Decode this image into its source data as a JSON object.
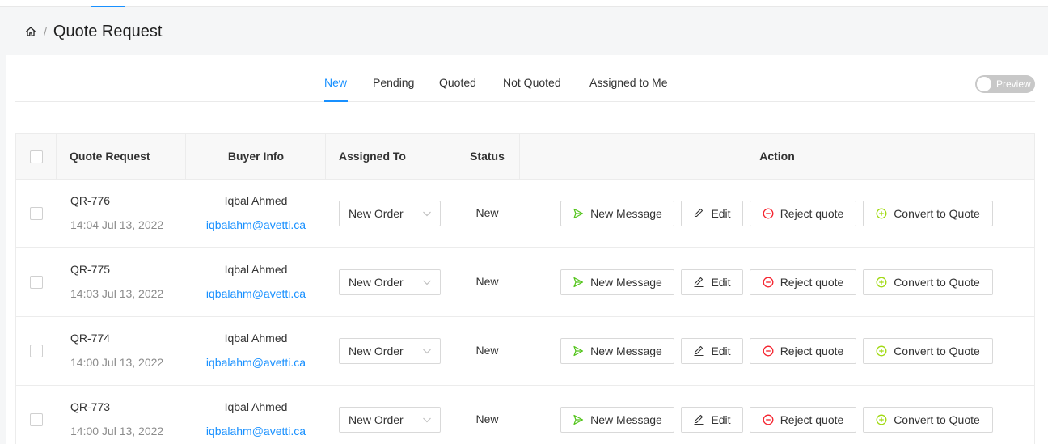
{
  "header": {
    "title": "Quote Request",
    "home_icon": "home-icon"
  },
  "tabs": [
    {
      "label": "New",
      "active": true
    },
    {
      "label": "Pending",
      "active": false
    },
    {
      "label": "Quoted",
      "active": false
    },
    {
      "label": "Not Quoted",
      "active": false
    },
    {
      "label": "Assigned to Me",
      "active": false
    }
  ],
  "preview_toggle": {
    "label": "Preview",
    "on": false
  },
  "table": {
    "columns": [
      "Quote Request",
      "Buyer Info",
      "Assigned To",
      "Status",
      "Action"
    ],
    "actions": {
      "new_message": "New Message",
      "edit": "Edit",
      "reject": "Reject quote",
      "convert": "Convert to Quote"
    },
    "rows": [
      {
        "id": "QR-776",
        "date": "14:04 Jul 13, 2022",
        "buyer_name": "Iqbal Ahmed",
        "buyer_email": "iqbalahm@avetti.ca",
        "assigned_to": "New Order",
        "status": "New"
      },
      {
        "id": "QR-775",
        "date": "14:03 Jul 13, 2022",
        "buyer_name": "Iqbal Ahmed",
        "buyer_email": "iqbalahm@avetti.ca",
        "assigned_to": "New Order",
        "status": "New"
      },
      {
        "id": "QR-774",
        "date": "14:00 Jul 13, 2022",
        "buyer_name": "Iqbal Ahmed",
        "buyer_email": "iqbalahm@avetti.ca",
        "assigned_to": "New Order",
        "status": "New"
      },
      {
        "id": "QR-773",
        "date": "14:00 Jul 13, 2022",
        "buyer_name": "Iqbal Ahmed",
        "buyer_email": "iqbalahm@avetti.ca",
        "assigned_to": "New Order",
        "status": "New"
      }
    ]
  },
  "colors": {
    "accent": "#1890ff",
    "send": "#52c41a",
    "reject": "#f5222d",
    "convert": "#a0d911"
  }
}
